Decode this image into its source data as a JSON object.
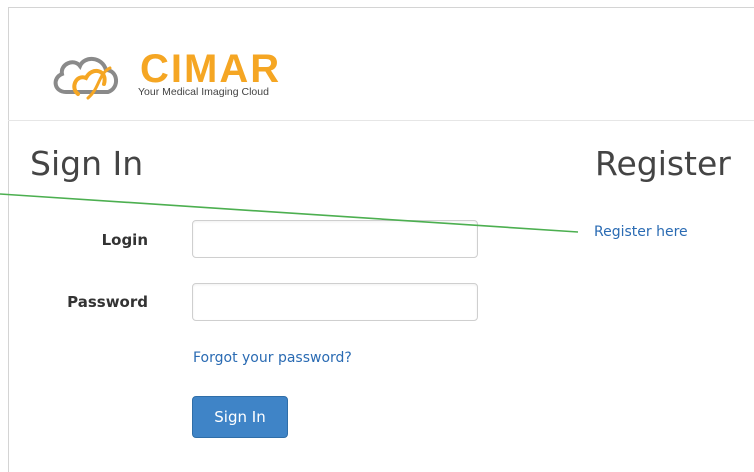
{
  "brand": {
    "name": "CIMAR",
    "tagline": "Your Medical Imaging Cloud",
    "accent_color": "#f5a623"
  },
  "signin": {
    "title": "Sign In",
    "login_label": "Login",
    "login_value": "",
    "password_label": "Password",
    "password_value": "",
    "forgot_link": "Forgot your password?",
    "submit_label": "Sign In"
  },
  "register": {
    "title": "Register",
    "link": "Register here"
  },
  "colors": {
    "link": "#2a6bb3",
    "button": "#3f84c7",
    "annotation_line": "#4caf50"
  },
  "icons": {
    "logo": "cloud-logo-icon"
  }
}
